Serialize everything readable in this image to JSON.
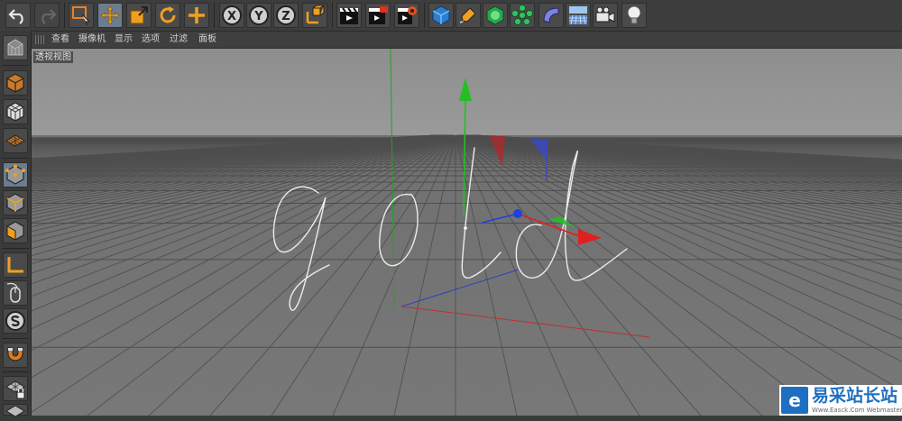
{
  "window": {
    "viewport_label": "透视视图"
  },
  "viewport_menu": [
    {
      "label": "查看"
    },
    {
      "label": "摄像机"
    },
    {
      "label": "显示"
    },
    {
      "label": "选项"
    },
    {
      "label": "过滤"
    },
    {
      "label": "面板"
    }
  ],
  "toolbar": {
    "axis_x": "X",
    "axis_y": "Y",
    "axis_z": "Z",
    "active_tool": "move-tool"
  },
  "viewport": {
    "spline_text": "gold"
  },
  "watermark": {
    "logo_glyph": "e",
    "title": "易采站长站",
    "subtitle": "Www.Easck.Com  Webmaster"
  },
  "colors": {
    "axis_x": "#e02020",
    "axis_y": "#20c020",
    "axis_z": "#2040e0",
    "active_button": "#6d7d8f",
    "brand_blue": "#1d6fc2"
  }
}
